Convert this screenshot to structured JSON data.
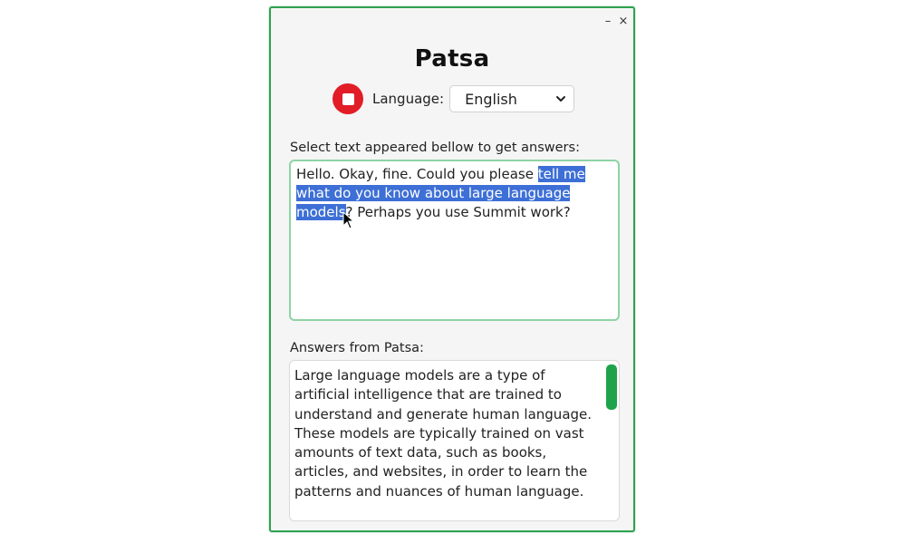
{
  "window": {
    "title": "Patsa",
    "controls": {
      "minimize": "–",
      "close": "×"
    }
  },
  "toolbar": {
    "record_icon": "stop-record-icon",
    "language_label": "Language:",
    "language_selected": "English"
  },
  "input_section": {
    "label": "Select text appeared bellow to get answers:",
    "text_before_selection": " Hello. Okay, fine. Could you please ",
    "selected_text": "tell me what do you know about large language models",
    "text_after_selection": "? Perhaps you use Summit work?"
  },
  "answer_section": {
    "label": "Answers from Patsa:",
    "lines": [
      "Large language models are a type of",
      "artificial intelligence that are trained to",
      "understand and generate human language.",
      "These models are typically trained on vast",
      "amounts of text data, such as books,",
      "articles, and websites, in order to learn the",
      "patterns and nuances of human language."
    ]
  },
  "colors": {
    "window_border": "#2fa14f",
    "record_button": "#e11d27",
    "selection": "#3d6fd6",
    "scroll_thumb": "#1ea34a"
  }
}
